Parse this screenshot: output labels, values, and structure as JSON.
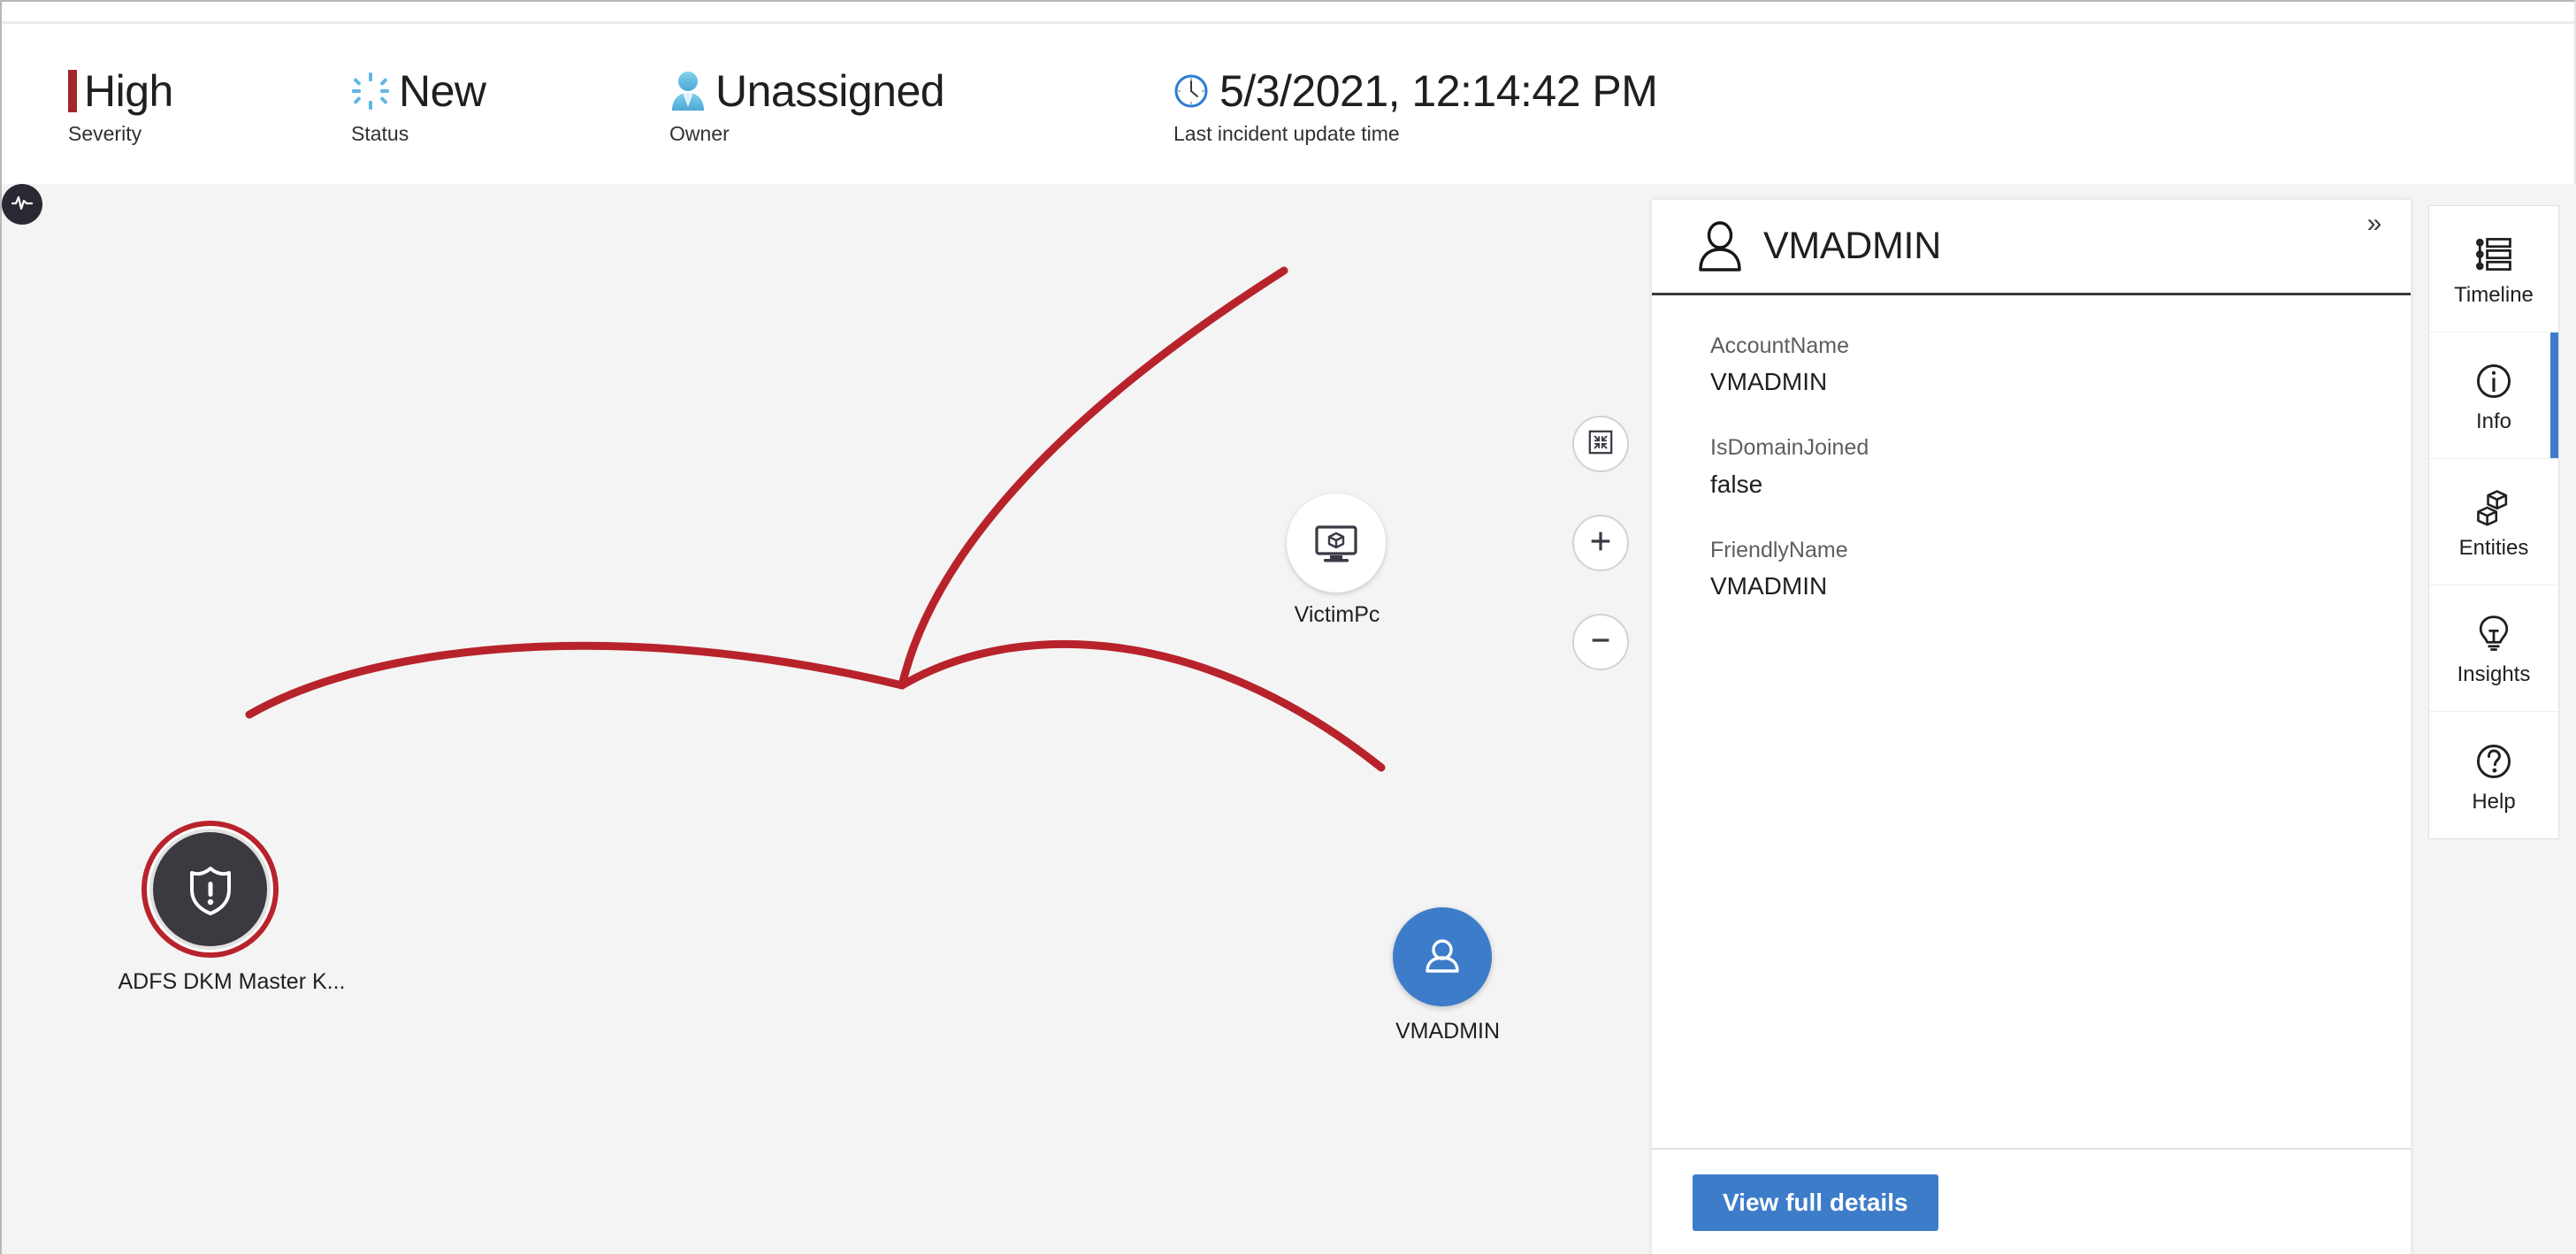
{
  "header": {
    "items": [
      {
        "icon": "severity-bar-icon",
        "value": "High",
        "label": "Severity"
      },
      {
        "icon": "status-new-icon",
        "value": "New",
        "label": "Status"
      },
      {
        "icon": "owner-person-icon",
        "value": "Unassigned",
        "label": "Owner"
      },
      {
        "icon": "clock-icon",
        "value": "5/3/2021, 12:14:42 PM",
        "label": "Last incident update time"
      }
    ]
  },
  "graph": {
    "nodes": [
      {
        "id": "alert",
        "label": "ADFS DKM Master K...",
        "icon": "shield-alert-icon",
        "kind": "alert"
      },
      {
        "id": "victimpc",
        "label": "VictimPc",
        "icon": "host-monitor-icon",
        "kind": "host"
      },
      {
        "id": "vmadmin",
        "label": "VMADMIN",
        "icon": "account-person-icon",
        "kind": "account",
        "selected": true
      },
      {
        "id": "activity",
        "label": "",
        "icon": "activity-pulse-icon",
        "kind": "edge-marker"
      }
    ],
    "edge_color": "#b8232b",
    "alert_ring_color": "#b8232b",
    "selected_node_color": "#3d7cc9"
  },
  "zoom_controls": [
    {
      "name": "fit-to-screen",
      "icon": "fit-screen-icon",
      "label": ""
    },
    {
      "name": "zoom-in",
      "icon": "plus-icon",
      "label": "+"
    },
    {
      "name": "zoom-out",
      "icon": "minus-icon",
      "label": "−"
    }
  ],
  "details_panel": {
    "title": "VMADMIN",
    "entity_icon": "account-person-icon",
    "collapse_icon": "chevron-double-right-icon",
    "properties": [
      {
        "key": "AccountName",
        "value": "VMADMIN"
      },
      {
        "key": "IsDomainJoined",
        "value": "false"
      },
      {
        "key": "FriendlyName",
        "value": "VMADMIN"
      }
    ],
    "footer_button": "View full details"
  },
  "right_rail": {
    "items": [
      {
        "label": "Timeline",
        "icon": "timeline-icon",
        "active": false
      },
      {
        "label": "Info",
        "icon": "info-circle-icon",
        "active": true
      },
      {
        "label": "Entities",
        "icon": "entities-cubes-icon",
        "active": false
      },
      {
        "label": "Insights",
        "icon": "lightbulb-icon",
        "active": false
      },
      {
        "label": "Help",
        "icon": "question-circle-icon",
        "active": false
      }
    ]
  },
  "colors": {
    "accent": "#3d7cc9",
    "severity_high": "#a4262c",
    "graph_bg": "#f4f4f4",
    "edge_red": "#b8232b"
  }
}
